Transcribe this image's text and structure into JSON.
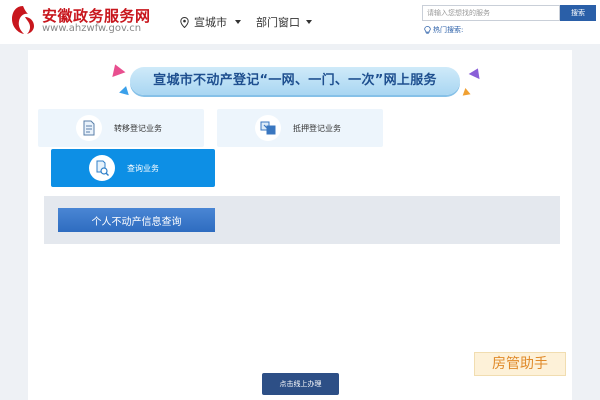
{
  "header": {
    "brand_name": "安徽政务服务网",
    "brand_url": "www.ahzwfw.gov.cn",
    "location": "宣城市",
    "department": "部门窗口",
    "search_placeholder": "请输入您想找的服务",
    "search_button": "搜索",
    "hot_search": "热门搜索:"
  },
  "banner": {
    "title": "宣城市不动产登记“一网、一门、一次”网上服务"
  },
  "services": [
    {
      "label": "转移登记业务",
      "icon": "document-icon"
    },
    {
      "label": "抵押登记业务",
      "icon": "transfer-icon"
    },
    {
      "label": "查询业务",
      "icon": "search-document-icon",
      "active": true
    }
  ],
  "query": {
    "button": "个人不动产信息查询"
  },
  "watermark": "房管助手",
  "submit_button": "点击线上办理",
  "colors": {
    "brand_red": "#c8161d",
    "primary_blue": "#2a5fa8",
    "active_blue": "#0d8fe5",
    "banner_text": "#1e4f8f"
  }
}
